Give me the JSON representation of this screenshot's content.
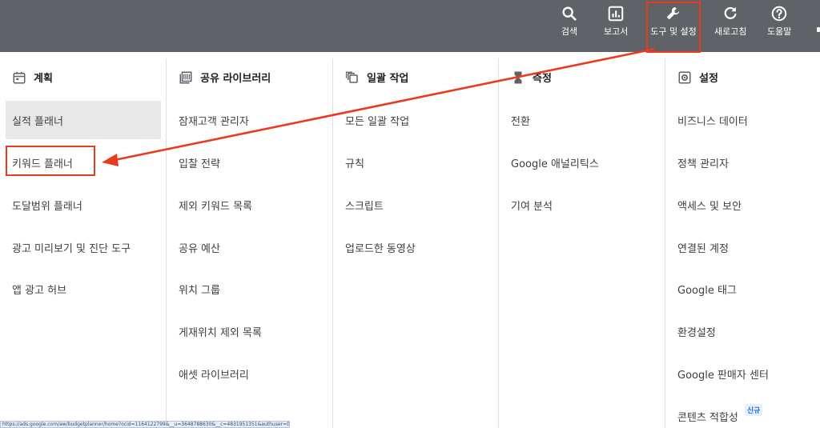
{
  "toolbar": {
    "items": [
      {
        "label": "검색",
        "icon": "search-icon"
      },
      {
        "label": "보고서",
        "icon": "reports-icon"
      },
      {
        "label": "도구 및 설정",
        "icon": "wrench-icon"
      },
      {
        "label": "새로고침",
        "icon": "refresh-icon"
      },
      {
        "label": "도움말",
        "icon": "help-icon"
      }
    ]
  },
  "menu": {
    "columns": [
      {
        "heading": "계획",
        "icon": "calendar-icon",
        "items": [
          "실적 플래너",
          "키워드 플래너",
          "도달범위 플래너",
          "광고 미리보기 및 진단 도구",
          "앱 광고 허브"
        ]
      },
      {
        "heading": "공유 라이브러리",
        "icon": "library-icon",
        "items": [
          "잠재고객 관리자",
          "입찰 전략",
          "제외 키워드 목록",
          "공유 예산",
          "위치 그룹",
          "게재위치 제외 목록",
          "애셋 라이브러리"
        ]
      },
      {
        "heading": "일괄 작업",
        "icon": "bulk-actions-icon",
        "items": [
          "모든 일괄 작업",
          "규칙",
          "스크립트",
          "업로드한 동영상"
        ]
      },
      {
        "heading": "측정",
        "icon": "hourglass-icon",
        "items": [
          "전환",
          "Google 애널리틱스",
          "기여 분석"
        ]
      },
      {
        "heading": "설정",
        "icon": "settings-icon",
        "items": [
          "비즈니스 데이터",
          "정책 관리자",
          "액세스 및 보안",
          "연결된 계정",
          "Google 태그",
          "환경설정",
          "Google 판매자 센터",
          "콘텐츠 적합성"
        ],
        "badge": "신규"
      }
    ]
  },
  "status_url": "https://ads.google.com/aw/budgetplanner/home?ocid=1164122799&__u=3648788630&__c=4831951351&authuser=0",
  "colors": {
    "topbar": "#5f6368",
    "highlight": "#ea3a1e",
    "selected_row": "#e8e8e8",
    "badge": "#1a73e8"
  }
}
